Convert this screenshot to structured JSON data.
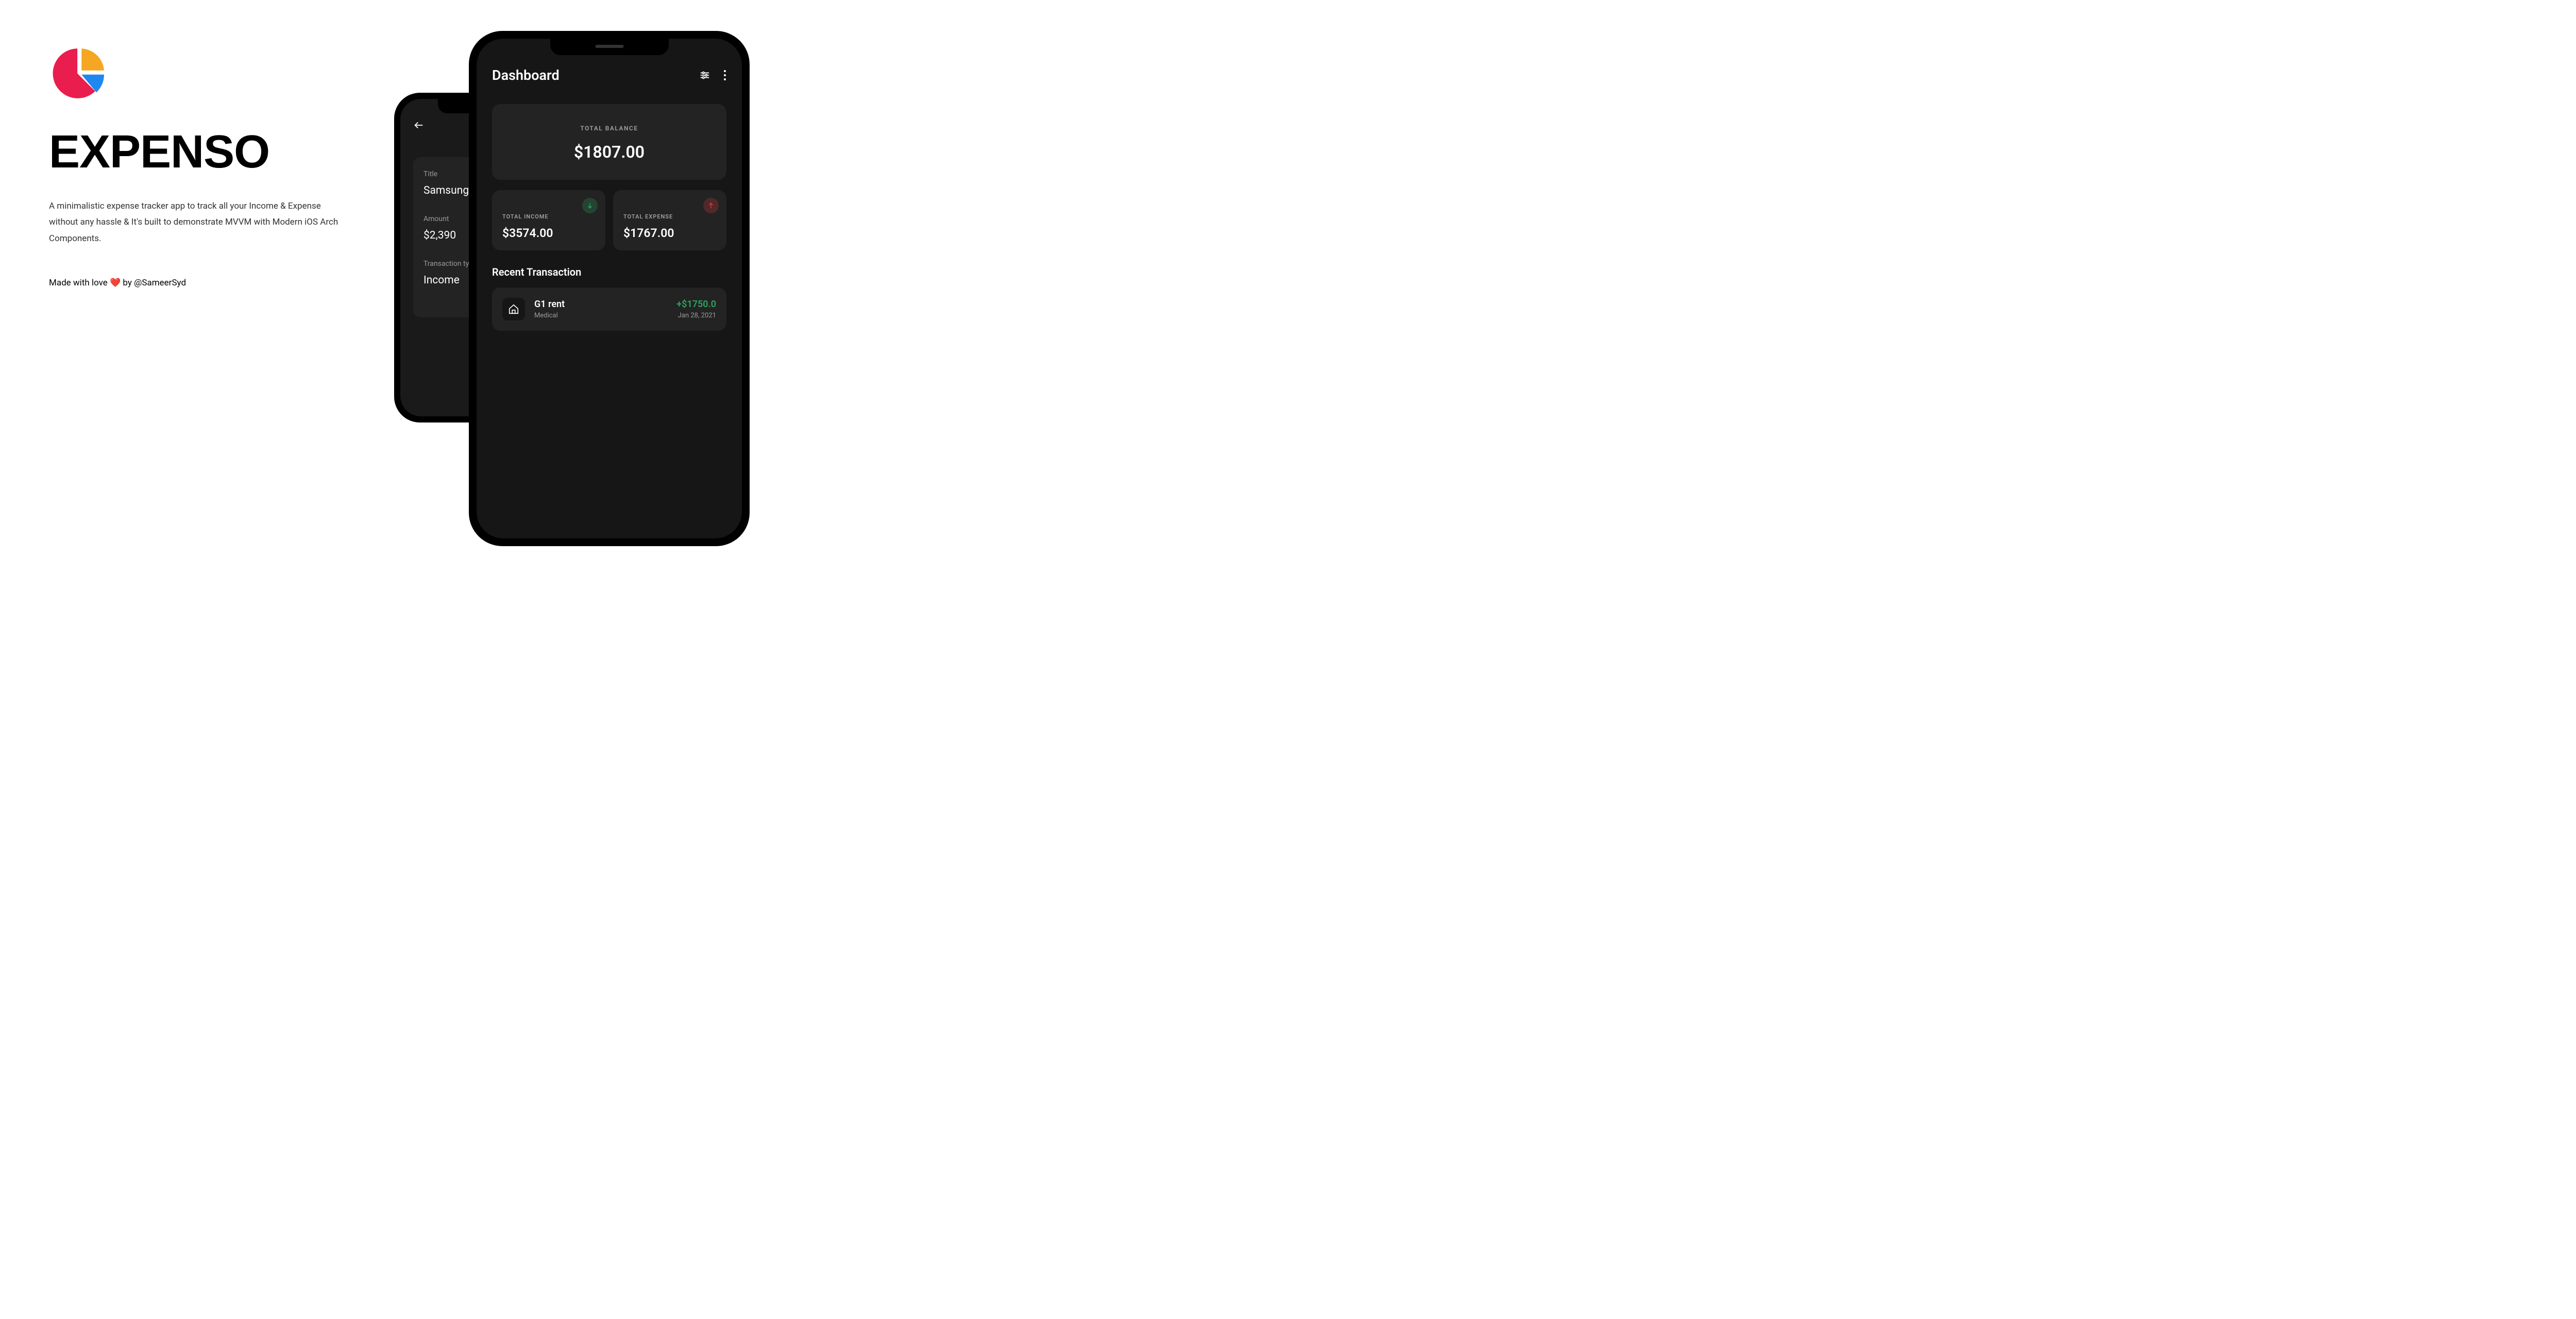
{
  "app": {
    "title": "EXPENSO",
    "description": "A minimalistic expense tracker app to track all your Income & Expense without any hassle & It's built to demonstrate MVVM with Modern iOS Arch Components.",
    "credit_prefix": "Made with love ",
    "credit_suffix": " by @SameerSyd"
  },
  "back_phone": {
    "title_label": "Title",
    "title_value": "Samsung I",
    "amount_label": "Amount",
    "amount_value": "$2,390",
    "type_label": "Transaction ty",
    "type_value": "Income"
  },
  "front_phone": {
    "header_title": "Dashboard",
    "balance": {
      "label": "TOTAL BALANCE",
      "value": "$1807.00"
    },
    "income": {
      "label": "TOTAL INCOME",
      "value": "$3574.00"
    },
    "expense": {
      "label": "TOTAL EXPENSE",
      "value": "$1767.00"
    },
    "recent_title": "Recent Transaction",
    "transaction": {
      "title": "G1 rent",
      "category": "Medical",
      "amount": "+$1750.0",
      "date": "Jan 28, 2021"
    }
  }
}
